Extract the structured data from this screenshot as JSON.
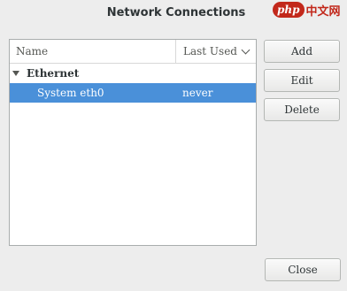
{
  "window": {
    "title": "Network Connections"
  },
  "watermark": {
    "badge": "php",
    "text": "中文网"
  },
  "list": {
    "columns": [
      "Name",
      "Last Used"
    ],
    "groups": [
      {
        "label": "Ethernet",
        "items": [
          {
            "name": "System eth0",
            "last_used": "never",
            "selected": true
          }
        ]
      }
    ]
  },
  "buttons": {
    "add": "Add",
    "edit": "Edit",
    "delete": "Delete",
    "close": "Close"
  },
  "colors": {
    "selection": "#4a90d9",
    "background": "#ededed"
  }
}
